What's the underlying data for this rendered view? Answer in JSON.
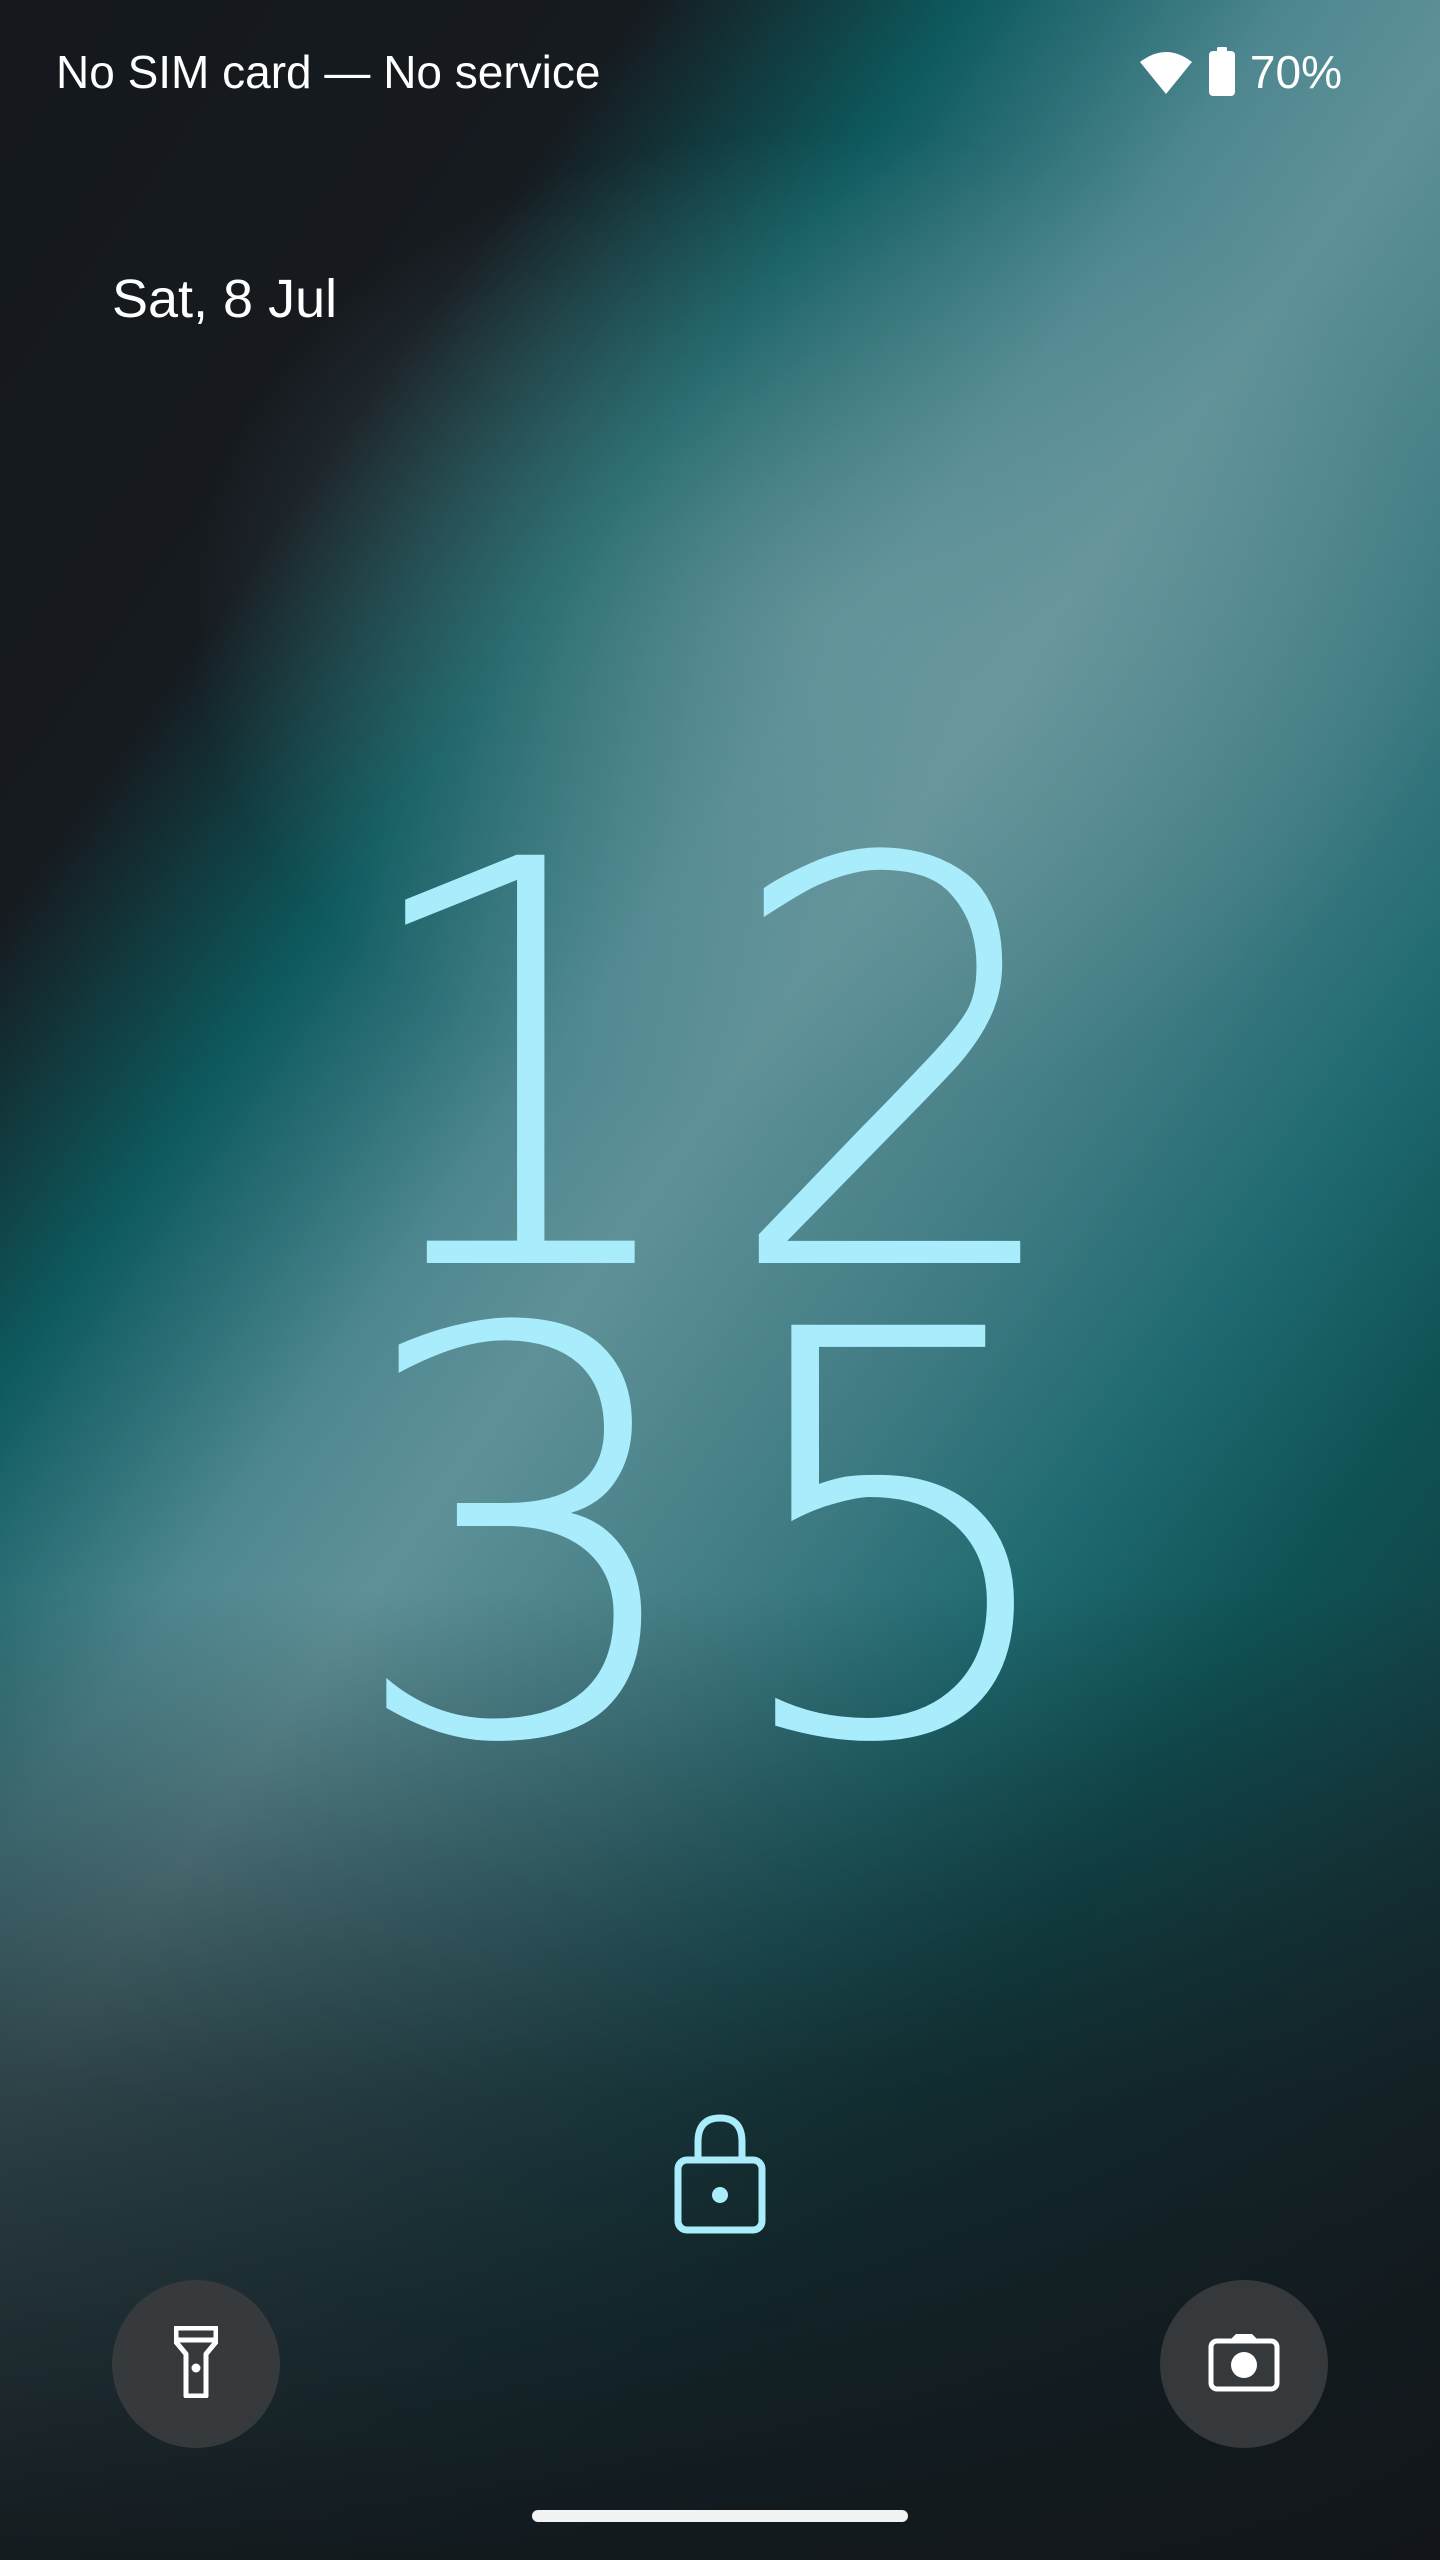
{
  "status_bar": {
    "carrier_text": "No SIM card — No service",
    "battery_percent": "70%",
    "wifi_icon": "wifi-icon",
    "battery_icon": "battery-icon",
    "battery_level": 0.7
  },
  "lockscreen": {
    "date": "Sat, 8 Jul",
    "clock_hours": "12",
    "clock_minutes": "35",
    "lock_icon": "lock-icon",
    "clock_color": "#a9ecfb"
  },
  "shortcuts": {
    "left_icon": "flashlight-icon",
    "right_icon": "camera-icon"
  }
}
